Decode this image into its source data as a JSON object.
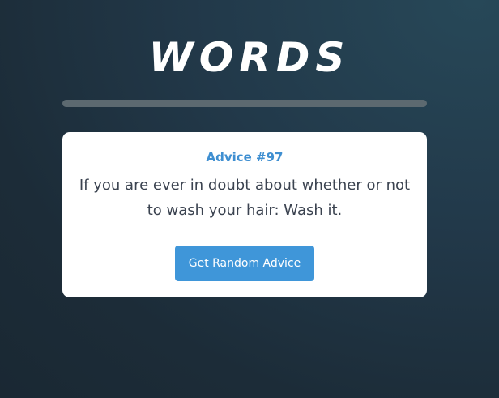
{
  "header": {
    "title": "WORDS"
  },
  "card": {
    "advice_number": "Advice #97",
    "advice_text": "If you are ever in doubt about whether or not to wash your hair: Wash it.",
    "button_label": "Get Random Advice"
  },
  "colors": {
    "accent": "#3f96d9",
    "advice_number": "#3f8fd1",
    "background": "#1f3240",
    "divider": "#5c6970",
    "card": "#ffffff",
    "text": "#3b4350"
  }
}
